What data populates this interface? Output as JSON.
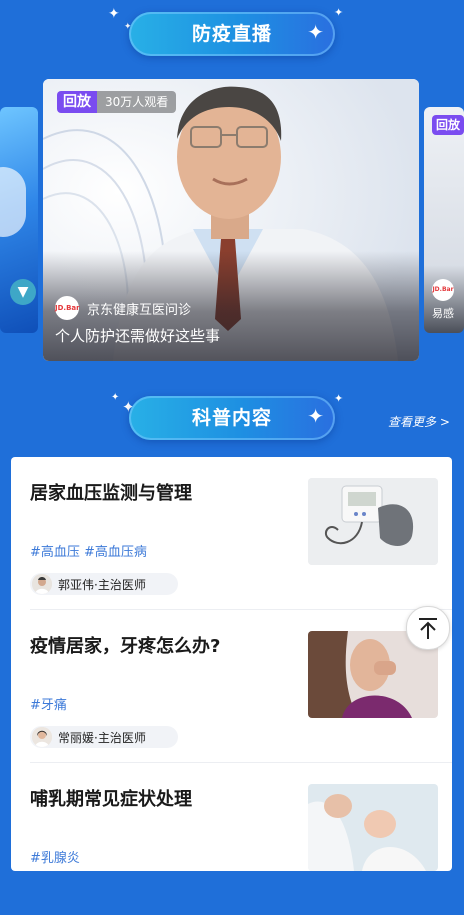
{
  "live_section": {
    "title": "防疫直播"
  },
  "main_card": {
    "badge_replay": "回放",
    "badge_views": "30万人观看",
    "source_label": "京东健康互医问诊",
    "logo_text": "JD.Bar",
    "caption": "个人防护还需做好这些事"
  },
  "right_card": {
    "badge_replay": "回放",
    "logo_text": "JD.Bar",
    "source_fragment": "易感"
  },
  "popular_section": {
    "title": "科普内容",
    "more_link": "查看更多 >"
  },
  "articles": [
    {
      "title": "居家血压监测与管理",
      "tags": "#高血压 #高血压病",
      "author": "郭亚伟·主治医师"
    },
    {
      "title": "疫情居家，牙疼怎么办?",
      "tags": "#牙痛",
      "author": "常丽媛·主治医师"
    },
    {
      "title": "哺乳期常见症状处理",
      "tags": "#乳腺炎"
    }
  ],
  "colors": {
    "background": "#1f6fd9",
    "replay_badge": "#7a4cf0",
    "tag": "#3d7ad8"
  },
  "icons": {
    "back_to_top": "arrow-up-to-line-icon",
    "play": "play-icon"
  }
}
